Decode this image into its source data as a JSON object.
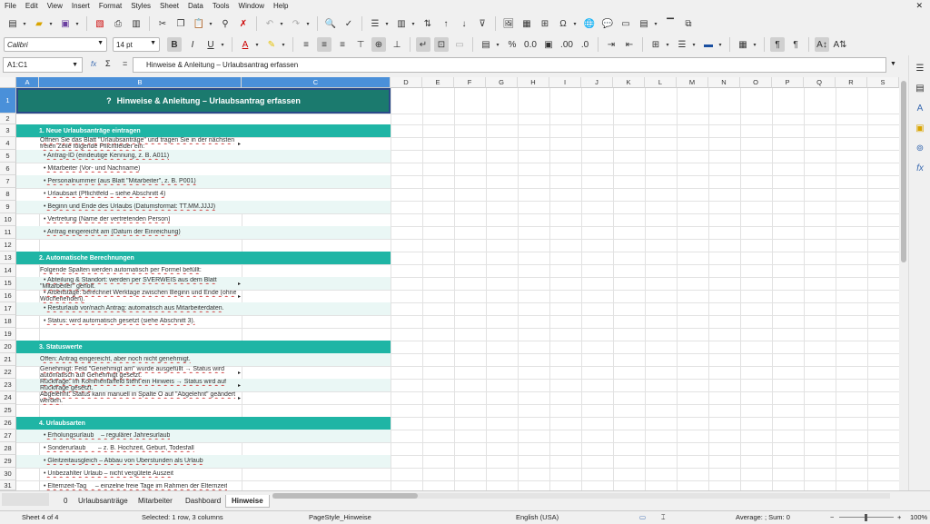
{
  "menu": [
    "File",
    "Edit",
    "View",
    "Insert",
    "Format",
    "Styles",
    "Sheet",
    "Data",
    "Tools",
    "Window",
    "Help"
  ],
  "close_glyph": "✕",
  "toolbar2": {
    "font_name": "Calibri",
    "font_size": "14 pt"
  },
  "formula_bar": {
    "name_box": "A1:C1",
    "fx": "fx",
    "sigma": "Σ",
    "equals": "=",
    "content": "Hinweise & Anleitung – Urlaubsantrag erfassen"
  },
  "columns": [
    "A",
    "B",
    "C",
    "D",
    "E",
    "F",
    "G",
    "H",
    "I",
    "J",
    "K",
    "L",
    "M",
    "N",
    "O",
    "P",
    "Q",
    "R",
    "S"
  ],
  "rows": [
    "1",
    "2",
    "3",
    "4",
    "5",
    "6",
    "7",
    "8",
    "9",
    "10",
    "11",
    "12",
    "13",
    "14",
    "15",
    "16",
    "17",
    "18",
    "19",
    "20",
    "21",
    "22",
    "23",
    "24",
    "25",
    "26",
    "27",
    "28",
    "29",
    "30",
    "31"
  ],
  "sheet": {
    "title": "Hinweise & Anleitung – Urlaubsantrag erfassen",
    "title_icon": "?",
    "sections": [
      {
        "label": "1. Neue Urlaubsanträge eintragen"
      },
      {
        "label": "2. Automatische Berechnungen"
      },
      {
        "label": "3. Statuswerte"
      },
      {
        "label": "4. Urlaubsarten"
      }
    ],
    "lines": {
      "r4a": "Öffnen Sie das Blatt \"Urlaubsanträge\" und tragen Sie in der nächsten",
      "r4b": "freien Zeile folgende Pflichtfelder ein:",
      "r5": "• Antrag-ID (eindeutige Kennung, z. B. A011)",
      "r6": "• Mitarbeiter (Vor- und Nachname)",
      "r7": "• Personalnummer (aus Blatt \"Mitarbeiter\", z. B. P001)",
      "r8": "• Urlaubsart (Pflichtfeld – siehe Abschnitt 4)",
      "r9": "• Beginn und Ende des Urlaubs (Datumsformat: TT.MM.JJJJ)",
      "r10": "• Vertretung (Name der vertretenden Person)",
      "r11": "• Antrag eingereicht am (Datum der Einreichung)",
      "r14": "Folgende Spalten werden automatisch per Formel befüllt:",
      "r15a": "• Abteilung & Standort: werden per SVERWEIS aus dem Blatt",
      "r15b": "\"Mitarbeiter\" geholt.",
      "r16a": "• Arbeitstage: berechnet Werktage zwischen Beginn und Ende (ohne",
      "r16b": "Wochenenden).",
      "r17": "• Resturlaub vor/nach Antrag: automatisch aus Mitarbeiterdaten.",
      "r18": "• Status: wird automatisch gesetzt (siehe Abschnitt 3).",
      "r21": "Offen:      Antrag eingereicht, aber noch nicht genehmigt.",
      "r22a": "Genehmigt:  Feld \"Genehmigt am\" wurde ausgefüllt → Status wird",
      "r22b": "automatisch auf Genehmigt gesetzt.",
      "r23a": "Rückfrage:  Im Kommentarfeld steht ein Hinweis → Status wird auf",
      "r23b": "Rückfrage gesetzt.",
      "r24a": "Abgelehnt:  Status kann manuell in Spalte O auf \"Abgelehnt\" geändert",
      "r24b": "werden.",
      "r27": "• Erholungsurlaub    – regulärer Jahresurlaub",
      "r28": "• Sonderurlaub       – z. B. Hochzeit, Geburt, Todesfall",
      "r29": "• Gleitzeitausgleich – Abbau von Überstunden als Urlaub",
      "r30": "• Unbezahlter Urlaub – nicht vergütete Auszeit",
      "r31": "• Elternzeit-Tag     – einzelne freie Tage im Rahmen der Elternzeit"
    }
  },
  "tabs": [
    "Urlaubsanträge",
    "Mitarbeiter",
    "Dashboard",
    "Hinweise"
  ],
  "tab_count": "0",
  "status": {
    "sheet": "Sheet 4 of 4",
    "selection": "Selected: 1 row, 3 columns",
    "pagestyle": "PageStyle_Hinweise",
    "language": "English (USA)",
    "sum": "Average: ; Sum: 0",
    "zoom": "100%"
  },
  "colors": {
    "title_bg": "#1b7a6e",
    "section_bg": "#1fb5a5",
    "selection": "#4a90d9"
  }
}
